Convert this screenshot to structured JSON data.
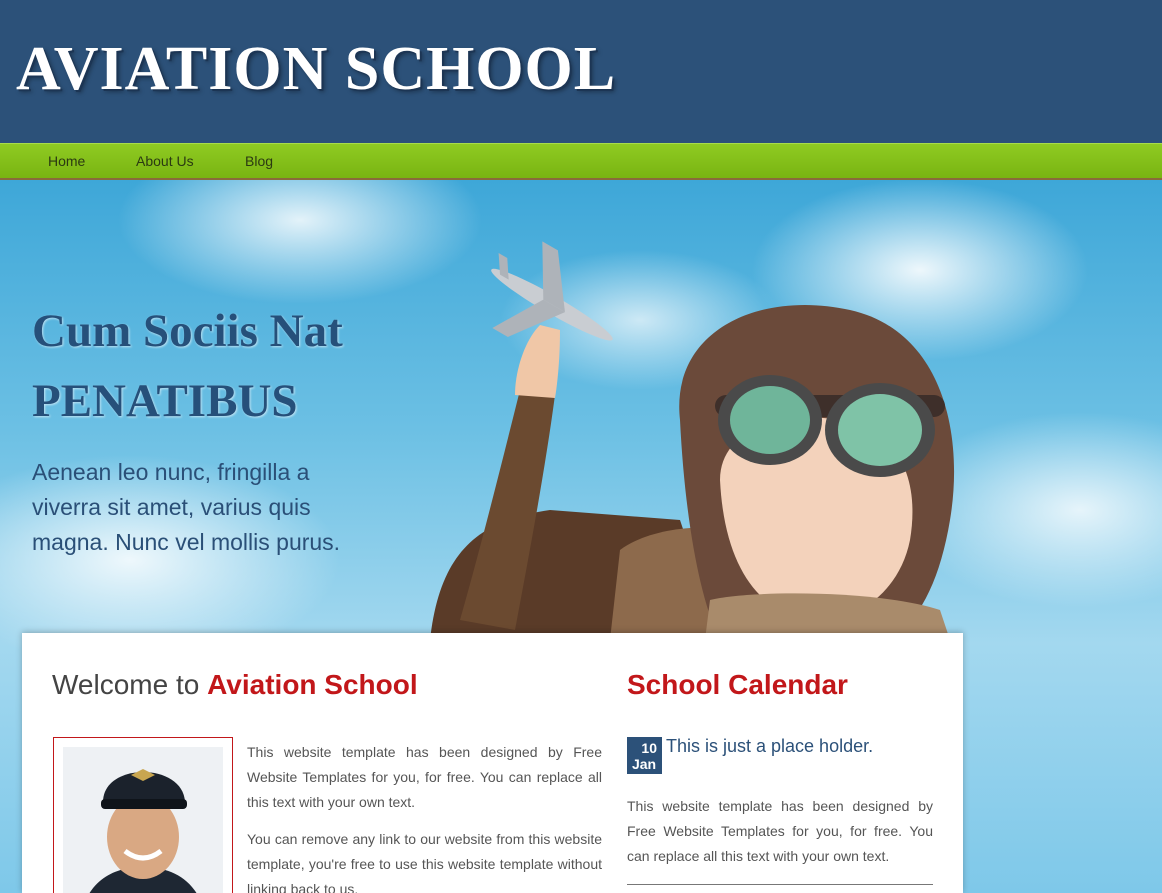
{
  "header": {
    "logo": "AVIATION SCHOOL"
  },
  "nav": {
    "items": [
      {
        "label": "Home"
      },
      {
        "label": "About Us"
      },
      {
        "label": "Blog"
      }
    ]
  },
  "hero": {
    "title_line_1": "Cum Sociis Nat",
    "title_line_2": "PENATIBUS",
    "text": "Aenean leo nunc, fringilla a viverra sit amet, varius quis magna. Nunc vel mollis purus."
  },
  "welcome": {
    "prefix": "Welcome to",
    "accent": "Aviation School",
    "paragraph_1": "This website template has been designed by Free Website Templates for you, for free. You can replace all this text with your own text.",
    "paragraph_2": "You can remove any link to our website from this website template, you're free to use this website template without linking back to us."
  },
  "calendar": {
    "title": "School Calendar",
    "event": {
      "day": "10",
      "month": "Jan",
      "title": "This is just a place holder.",
      "text": "This website template has been designed by Free Website Templates for you, for free. You can replace all this text with your own text."
    }
  },
  "colors": {
    "header": "#2c5179",
    "nav": "#84c01a",
    "accent": "#c2171a"
  }
}
